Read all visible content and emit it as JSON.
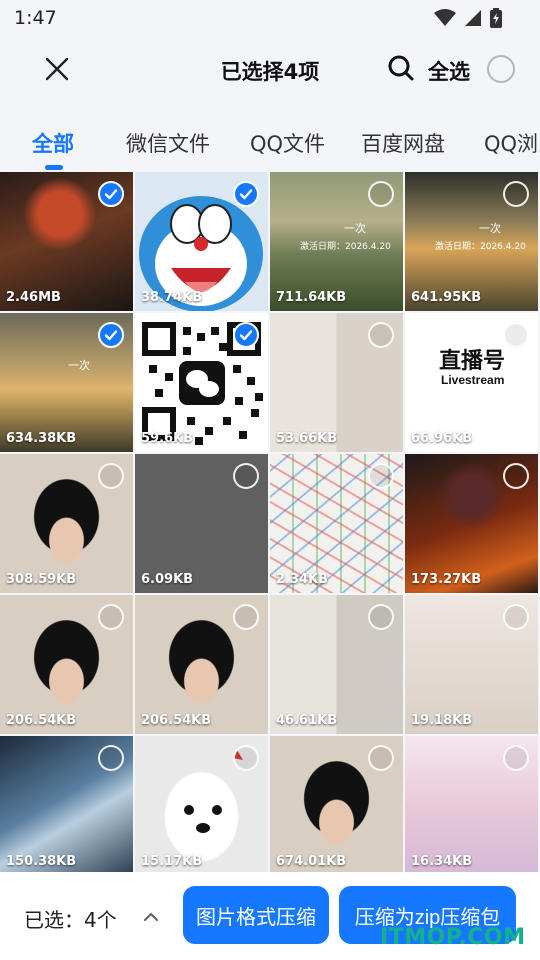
{
  "status_bar": {
    "time": "1:47"
  },
  "header": {
    "title": "已选择4项",
    "select_all": "全选"
  },
  "tabs": [
    {
      "label": "全部",
      "active": true
    },
    {
      "label": "微信文件",
      "active": false
    },
    {
      "label": "QQ文件",
      "active": false
    },
    {
      "label": "百度网盘",
      "active": false
    },
    {
      "label": "QQ浏览器",
      "active": false
    }
  ],
  "images": [
    {
      "size": "2.46MB",
      "selected": true
    },
    {
      "size": "38.74KB",
      "selected": true
    },
    {
      "size": "711.64KB",
      "selected": false
    },
    {
      "size": "641.95KB",
      "selected": false
    },
    {
      "size": "634.38KB",
      "selected": true
    },
    {
      "size": "59.6KB",
      "selected": true
    },
    {
      "size": "53.66KB",
      "selected": false
    },
    {
      "size": "66.96KB",
      "selected": false
    },
    {
      "size": "308.59KB",
      "selected": false
    },
    {
      "size": "6.09KB",
      "selected": false
    },
    {
      "size": "2.34KB",
      "selected": false
    },
    {
      "size": "173.27KB",
      "selected": false
    },
    {
      "size": "206.54KB",
      "selected": false
    },
    {
      "size": "206.54KB",
      "selected": false
    },
    {
      "size": "46.61KB",
      "selected": false
    },
    {
      "size": "19.18KB",
      "selected": false
    },
    {
      "size": "150.38KB",
      "selected": false
    },
    {
      "size": "15.17KB",
      "selected": false
    },
    {
      "size": "674.01KB",
      "selected": false
    },
    {
      "size": "16.34KB",
      "selected": false
    }
  ],
  "image_texts": {
    "park_caption_1": "激活日期：2026.4.20",
    "park_caption_2": "激活日期：2026.4.20",
    "park_line": "一次",
    "livestream_brand": "直播号",
    "livestream_sub": "Livestream"
  },
  "footer": {
    "selected_count": "已选：4个",
    "format_button": "图片格式压缩",
    "zip_button": "压缩为zip压缩包"
  },
  "watermark": "ITMOP.COM",
  "colors": {
    "accent": "#1677ff",
    "watermark": "#13b18c"
  }
}
